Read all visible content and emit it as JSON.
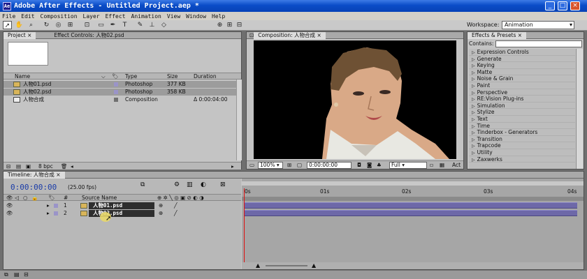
{
  "window": {
    "title": "Adobe After Effects - Untitled Project.aep *",
    "minimize": "_",
    "maximize": "□",
    "close": "×"
  },
  "menu": [
    "File",
    "Edit",
    "Composition",
    "Layer",
    "Effect",
    "Animation",
    "View",
    "Window",
    "Help"
  ],
  "toolbar": {
    "workspace_label": "Workspace:",
    "workspace_value": "Animation"
  },
  "project_panel": {
    "tabs": [
      "Project",
      "Effect Controls: 人物02.psd"
    ],
    "columns": [
      "Name",
      "Type",
      "Size",
      "Duration"
    ],
    "items": [
      {
        "name": "人物01.psd",
        "type": "Photoshop",
        "size": "377 KB",
        "duration": "",
        "label_color": "#9a94c8"
      },
      {
        "name": "人物02.psd",
        "type": "Photoshop",
        "size": "358 KB",
        "duration": "",
        "label_color": "#9a94c8"
      },
      {
        "name": "人物合成",
        "type": "Composition",
        "size": "",
        "duration": "Δ 0:00:04:00",
        "label_color": "#707070"
      }
    ],
    "bit_depth": "8 bpc"
  },
  "composition_panel": {
    "tab": "Composition: 人物合成",
    "zoom": "100%",
    "timecode": "0:00:00:00",
    "resolution": "Full",
    "active_label": "Act"
  },
  "effects_panel": {
    "tab": "Effects & Presets",
    "contains_label": "Contains:",
    "contains_value": "",
    "categories": [
      "Expression Controls",
      "Generate",
      "Keying",
      "Matte",
      "Noise & Grain",
      "Paint",
      "Perspective",
      "RE:Vision Plug-ins",
      "Simulation",
      "Stylize",
      "Text",
      "Time",
      "Tinderbox - Generators",
      "Transition",
      "Trapcode",
      "Utility",
      "Zaxwerks"
    ]
  },
  "timeline": {
    "tab": "Timeline: 人物合成",
    "timecode": "0:00:00:00",
    "fps": "(25.00 fps)",
    "columns": {
      "number": "#",
      "source_name": "Source Name"
    },
    "layers": [
      {
        "number": "1",
        "name": "人物01.psd"
      },
      {
        "number": "2",
        "name": "人物02.psd"
      }
    ],
    "ruler_ticks": [
      "0s",
      "01s",
      "02s",
      "03s",
      "04s"
    ]
  }
}
